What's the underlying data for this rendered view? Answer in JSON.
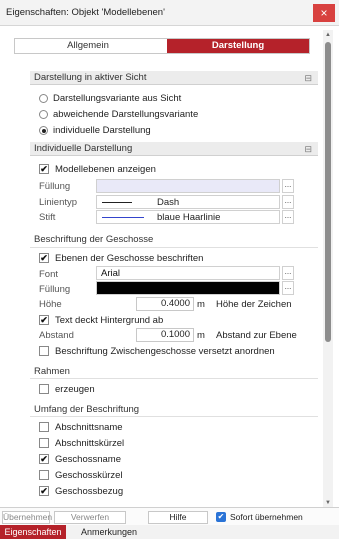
{
  "window": {
    "title": "Eigenschaften: Objekt 'Modellebenen'",
    "close_icon": "×"
  },
  "tabs": {
    "allgemein": "Allgemein",
    "darstellung": "Darstellung"
  },
  "sections": {
    "aktive_sicht": {
      "title": "Darstellung in aktiver Sicht",
      "options": [
        "Darstellungsvariante aus Sicht",
        "abweichende Darstellungsvariante",
        "individuelle Darstellung"
      ],
      "selected_index": 2
    },
    "individuelle": {
      "title": "Individuelle Darstellung",
      "anzeigen_label": "Modellebenen anzeigen",
      "fuellung_label": "Füllung",
      "linientyp_label": "Linientyp",
      "linientyp_value": "Dash",
      "stift_label": "Stift",
      "stift_value": "blaue Haarlinie",
      "dots": "..."
    },
    "beschriftung": {
      "title": "Beschriftung der Geschosse",
      "beschriften_label": "Ebenen der Geschosse beschriften",
      "font_label": "Font",
      "font_value": "Arial",
      "fuellung_label": "Füllung",
      "hoehe_label": "Höhe",
      "hoehe_value": "0.4000",
      "hoehe_unit": "m",
      "hoehe_desc": "Höhe der Zeichen",
      "hintergrund_label": "Text deckt Hintergrund ab",
      "abstand_label": "Abstand",
      "abstand_value": "0.1000",
      "abstand_unit": "m",
      "abstand_desc": "Abstand zur Ebene",
      "versetzt_label": "Beschriftung Zwischengeschosse versetzt anordnen"
    },
    "rahmen": {
      "title": "Rahmen",
      "erzeugen_label": "erzeugen"
    },
    "umfang": {
      "title": "Umfang der Beschriftung",
      "items": [
        {
          "label": "Abschnittsname",
          "checked": false
        },
        {
          "label": "Abschnittskürzel",
          "checked": false
        },
        {
          "label": "Geschossname",
          "checked": true
        },
        {
          "label": "Geschosskürzel",
          "checked": false
        },
        {
          "label": "Geschossbezug",
          "checked": true
        }
      ]
    }
  },
  "footer": {
    "uebernehmen": "Übernehmen",
    "verwerfen": "Verwerfen",
    "hilfe": "Hilfe",
    "sofort": "Sofort übernehmen"
  },
  "bottom_tabs": {
    "eigenschaften": "Eigenschaften",
    "anmerkungen": "Anmerkungen"
  },
  "colors": {
    "accent": "#b5222a",
    "close": "#d8413f",
    "checkbox_blue": "#2a73d6",
    "stift_line": "#3344cc"
  }
}
